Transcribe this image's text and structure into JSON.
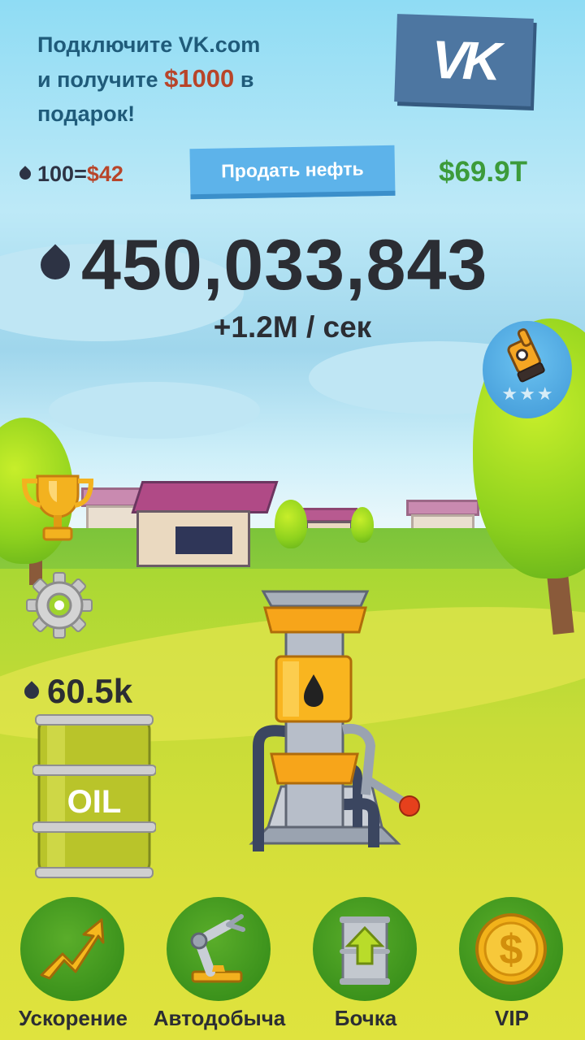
{
  "promo": {
    "line1": "Подключите VK.com",
    "line2_prefix": "и получите",
    "line2_amount": "$1000",
    "line2_suffix": "в",
    "line3": "подарок!",
    "vk_logo": "VK"
  },
  "exchange": {
    "oil_amount": "100",
    "equals": "=",
    "price": "$42"
  },
  "sell_button": "Продать нефть",
  "balance": "$69.9T",
  "oil_total": "450,033,843",
  "rate_per_sec": "+1.2M / сек",
  "tap_upgrade": {
    "icon": "gloved-hand-icon",
    "stars": "★★★"
  },
  "side": {
    "trophy_icon": "trophy-icon",
    "settings_icon": "gear-icon",
    "barrel_capacity": "60.5k",
    "barrel_label": "OIL"
  },
  "nav": [
    {
      "label": "Ускорение",
      "icon": "boost-arrow-icon"
    },
    {
      "label": "Автодобыча",
      "icon": "robot-arm-icon"
    },
    {
      "label": "Бочка",
      "icon": "barrel-upgrade-icon"
    },
    {
      "label": "VIP",
      "icon": "gold-coin-icon"
    }
  ],
  "colors": {
    "money_green": "#3c9b3a",
    "price_red": "#b8452a",
    "sell_button_blue": "#5db3ea",
    "vk_blue": "#4d76a1",
    "nav_green": "#3f9a1f"
  }
}
